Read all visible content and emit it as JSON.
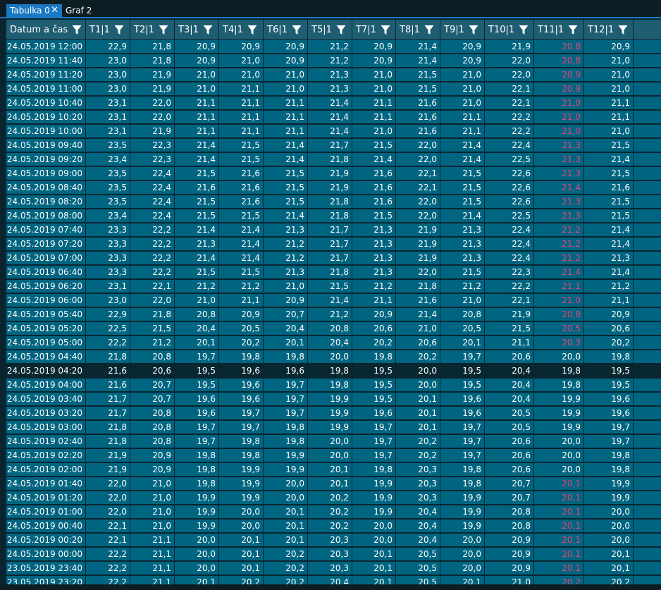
{
  "tabs": [
    {
      "label": "Tabulka 0",
      "active": true
    },
    {
      "label": "Graf 2",
      "active": false
    }
  ],
  "close_glyph": "✕",
  "table": {
    "columns": [
      "Datum a čas",
      "T1|1",
      "T2|1",
      "T3|1",
      "T4|1",
      "T6|1",
      "T5|1",
      "T7|1",
      "T8|1",
      "T9|1",
      "T10|1",
      "T11|1",
      "T12|1"
    ],
    "highlight_color": "#e0457c",
    "selected_row": 23,
    "rows": [
      {
        "t": "24.05.2019 12:00",
        "v": [
          "22,9",
          "21,8",
          "20,9",
          "20,9",
          "20,9",
          "21,2",
          "20,9",
          "21,4",
          "20,9",
          "21,9",
          "20,8",
          "20,9"
        ],
        "hi": true
      },
      {
        "t": "24.05.2019 11:40",
        "v": [
          "23,0",
          "21,8",
          "20,9",
          "21,0",
          "20,9",
          "21,2",
          "20,9",
          "21,4",
          "20,9",
          "22,0",
          "20,8",
          "21,0"
        ],
        "hi": true
      },
      {
        "t": "24.05.2019 11:20",
        "v": [
          "23,0",
          "21,9",
          "21,0",
          "21,0",
          "21,0",
          "21,3",
          "21,0",
          "21,5",
          "21,0",
          "22,0",
          "20,9",
          "21,0"
        ],
        "hi": true
      },
      {
        "t": "24.05.2019 11:00",
        "v": [
          "23,0",
          "21,9",
          "21,0",
          "21,1",
          "21,0",
          "21,3",
          "21,0",
          "21,5",
          "21,0",
          "22,1",
          "20,9",
          "21,0"
        ],
        "hi": true
      },
      {
        "t": "24.05.2019 10:40",
        "v": [
          "23,1",
          "22,0",
          "21,1",
          "21,1",
          "21,1",
          "21,4",
          "21,1",
          "21,6",
          "21,0",
          "22,1",
          "21,0",
          "21,1"
        ],
        "hi": true
      },
      {
        "t": "24.05.2019 10:20",
        "v": [
          "23,1",
          "22,0",
          "21,1",
          "21,1",
          "21,1",
          "21,4",
          "21,1",
          "21,6",
          "21,1",
          "22,2",
          "21,0",
          "21,1"
        ],
        "hi": true
      },
      {
        "t": "24.05.2019 10:00",
        "v": [
          "23,1",
          "21,9",
          "21,1",
          "21,1",
          "21,1",
          "21,4",
          "21,0",
          "21,6",
          "21,1",
          "22,2",
          "21,0",
          "21,0"
        ],
        "hi": true
      },
      {
        "t": "24.05.2019 09:40",
        "v": [
          "23,5",
          "22,3",
          "21,4",
          "21,5",
          "21,4",
          "21,7",
          "21,5",
          "22,0",
          "21,4",
          "22,4",
          "21,3",
          "21,5"
        ],
        "hi": true
      },
      {
        "t": "24.05.2019 09:20",
        "v": [
          "23,4",
          "22,3",
          "21,4",
          "21,5",
          "21,4",
          "21,8",
          "21,4",
          "22,0",
          "21,4",
          "22,5",
          "21,3",
          "21,4"
        ],
        "hi": true
      },
      {
        "t": "24.05.2019 09:00",
        "v": [
          "23,5",
          "22,4",
          "21,5",
          "21,6",
          "21,5",
          "21,9",
          "21,6",
          "22,1",
          "21,5",
          "22,6",
          "21,3",
          "21,5"
        ],
        "hi": true
      },
      {
        "t": "24.05.2019 08:40",
        "v": [
          "23,5",
          "22,4",
          "21,6",
          "21,6",
          "21,5",
          "21,9",
          "21,6",
          "22,1",
          "21,5",
          "22,6",
          "21,4",
          "21,6"
        ],
        "hi": true
      },
      {
        "t": "24.05.2019 08:20",
        "v": [
          "23,5",
          "22,4",
          "21,5",
          "21,6",
          "21,5",
          "21,8",
          "21,6",
          "22,0",
          "21,5",
          "22,6",
          "21,3",
          "21,5"
        ],
        "hi": true
      },
      {
        "t": "24.05.2019 08:00",
        "v": [
          "23,4",
          "22,4",
          "21,5",
          "21,5",
          "21,4",
          "21,8",
          "21,5",
          "22,0",
          "21,4",
          "22,5",
          "21,3",
          "21,5"
        ],
        "hi": true
      },
      {
        "t": "24.05.2019 07:40",
        "v": [
          "23,3",
          "22,2",
          "21,4",
          "21,4",
          "21,3",
          "21,7",
          "21,3",
          "21,9",
          "21,3",
          "22,4",
          "21,2",
          "21,4"
        ],
        "hi": true
      },
      {
        "t": "24.05.2019 07:20",
        "v": [
          "23,3",
          "22,2",
          "21,3",
          "21,4",
          "21,2",
          "21,7",
          "21,3",
          "21,9",
          "21,3",
          "22,4",
          "21,2",
          "21,4"
        ],
        "hi": true
      },
      {
        "t": "24.05.2019 07:00",
        "v": [
          "23,3",
          "22,2",
          "21,4",
          "21,4",
          "21,2",
          "21,7",
          "21,3",
          "21,9",
          "21,3",
          "22,4",
          "21,2",
          "21,3"
        ],
        "hi": true
      },
      {
        "t": "24.05.2019 06:40",
        "v": [
          "23,3",
          "22,2",
          "21,5",
          "21,5",
          "21,3",
          "21,8",
          "21,3",
          "22,0",
          "21,5",
          "22,3",
          "21,4",
          "21,4"
        ],
        "hi": true
      },
      {
        "t": "24.05.2019 06:20",
        "v": [
          "23,1",
          "22,1",
          "21,2",
          "21,2",
          "21,0",
          "21,5",
          "21,2",
          "21,8",
          "21,2",
          "22,2",
          "21,1",
          "21,2"
        ],
        "hi": true
      },
      {
        "t": "24.05.2019 06:00",
        "v": [
          "23,0",
          "22,0",
          "21,0",
          "21,1",
          "20,9",
          "21,4",
          "21,1",
          "21,6",
          "21,0",
          "22,1",
          "21,0",
          "21,1"
        ],
        "hi": true
      },
      {
        "t": "24.05.2019 05:40",
        "v": [
          "22,9",
          "21,8",
          "20,8",
          "20,9",
          "20,7",
          "21,2",
          "20,9",
          "21,4",
          "20,8",
          "21,9",
          "20,8",
          "20,9"
        ],
        "hi": true
      },
      {
        "t": "24.05.2019 05:20",
        "v": [
          "22,5",
          "21,5",
          "20,4",
          "20,5",
          "20,4",
          "20,8",
          "20,6",
          "21,0",
          "20,5",
          "21,5",
          "20,5",
          "20,6"
        ],
        "hi": true
      },
      {
        "t": "24.05.2019 05:00",
        "v": [
          "22,2",
          "21,2",
          "20,1",
          "20,2",
          "20,1",
          "20,4",
          "20,2",
          "20,6",
          "20,1",
          "21,1",
          "20,3",
          "20,2"
        ],
        "hi": true
      },
      {
        "t": "24.05.2019 04:40",
        "v": [
          "21,8",
          "20,8",
          "19,7",
          "19,8",
          "19,8",
          "20,0",
          "19,8",
          "20,2",
          "19,7",
          "20,6",
          "20,0",
          "19,8"
        ],
        "hi": false
      },
      {
        "t": "24.05.2019 04:20",
        "v": [
          "21,6",
          "20,6",
          "19,5",
          "19,6",
          "19,6",
          "19,8",
          "19,5",
          "20,0",
          "19,5",
          "20,4",
          "19,8",
          "19,5"
        ],
        "hi": false
      },
      {
        "t": "24.05.2019 04:00",
        "v": [
          "21,6",
          "20,7",
          "19,5",
          "19,6",
          "19,7",
          "19,8",
          "19,5",
          "20,0",
          "19,5",
          "20,4",
          "19,8",
          "19,5"
        ],
        "hi": false
      },
      {
        "t": "24.05.2019 03:40",
        "v": [
          "21,7",
          "20,7",
          "19,6",
          "19,6",
          "19,7",
          "19,9",
          "19,5",
          "20,1",
          "19,6",
          "20,4",
          "19,9",
          "19,6"
        ],
        "hi": false
      },
      {
        "t": "24.05.2019 03:20",
        "v": [
          "21,7",
          "20,8",
          "19,6",
          "19,7",
          "19,7",
          "19,9",
          "19,6",
          "20,1",
          "19,6",
          "20,5",
          "19,9",
          "19,6"
        ],
        "hi": false
      },
      {
        "t": "24.05.2019 03:00",
        "v": [
          "21,8",
          "20,8",
          "19,7",
          "19,7",
          "19,8",
          "19,9",
          "19,7",
          "20,1",
          "19,7",
          "20,5",
          "19,9",
          "19,7"
        ],
        "hi": false
      },
      {
        "t": "24.05.2019 02:40",
        "v": [
          "21,8",
          "20,8",
          "19,7",
          "19,8",
          "19,8",
          "20,0",
          "19,7",
          "20,2",
          "19,7",
          "20,6",
          "20,0",
          "19,7"
        ],
        "hi": false
      },
      {
        "t": "24.05.2019 02:20",
        "v": [
          "21,9",
          "20,9",
          "19,8",
          "19,8",
          "19,9",
          "20,0",
          "19,7",
          "20,2",
          "19,7",
          "20,6",
          "20,0",
          "19,8"
        ],
        "hi": false
      },
      {
        "t": "24.05.2019 02:00",
        "v": [
          "21,9",
          "20,9",
          "19,8",
          "19,9",
          "19,9",
          "20,1",
          "19,8",
          "20,3",
          "19,8",
          "20,6",
          "20,0",
          "19,8"
        ],
        "hi": false
      },
      {
        "t": "24.05.2019 01:40",
        "v": [
          "22,0",
          "21,0",
          "19,8",
          "19,9",
          "20,0",
          "20,1",
          "19,9",
          "20,3",
          "19,8",
          "20,7",
          "20,1",
          "19,9"
        ],
        "hi": true
      },
      {
        "t": "24.05.2019 01:20",
        "v": [
          "22,0",
          "21,0",
          "19,9",
          "19,9",
          "20,0",
          "20,2",
          "19,9",
          "20,3",
          "19,9",
          "20,7",
          "20,1",
          "19,9"
        ],
        "hi": true
      },
      {
        "t": "24.05.2019 01:00",
        "v": [
          "22,0",
          "21,0",
          "19,9",
          "20,0",
          "20,1",
          "20,2",
          "19,9",
          "20,4",
          "19,9",
          "20,8",
          "20,1",
          "20,0"
        ],
        "hi": true
      },
      {
        "t": "24.05.2019 00:40",
        "v": [
          "22,1",
          "21,0",
          "19,9",
          "20,0",
          "20,1",
          "20,2",
          "20,0",
          "20,4",
          "19,9",
          "20,8",
          "20,1",
          "20,0"
        ],
        "hi": true
      },
      {
        "t": "24.05.2019 00:20",
        "v": [
          "22,1",
          "21,1",
          "20,0",
          "20,1",
          "20,1",
          "20,3",
          "20,0",
          "20,4",
          "20,0",
          "20,9",
          "20,1",
          "20,0"
        ],
        "hi": true
      },
      {
        "t": "24.05.2019 00:00",
        "v": [
          "22,2",
          "21,1",
          "20,0",
          "20,1",
          "20,2",
          "20,3",
          "20,1",
          "20,5",
          "20,0",
          "20,9",
          "20,1",
          "20,1"
        ],
        "hi": true
      },
      {
        "t": "23.05.2019 23:40",
        "v": [
          "22,2",
          "21,1",
          "20,0",
          "20,1",
          "20,2",
          "20,3",
          "20,1",
          "20,5",
          "20,0",
          "20,9",
          "20,1",
          "20,1"
        ],
        "hi": true
      },
      {
        "t": "23.05.2019 23:20",
        "v": [
          "22,2",
          "21,1",
          "20,1",
          "20,2",
          "20,2",
          "20,4",
          "20,1",
          "20,5",
          "20,1",
          "21,0",
          "20,2",
          "20,2"
        ],
        "hi": true
      }
    ]
  }
}
